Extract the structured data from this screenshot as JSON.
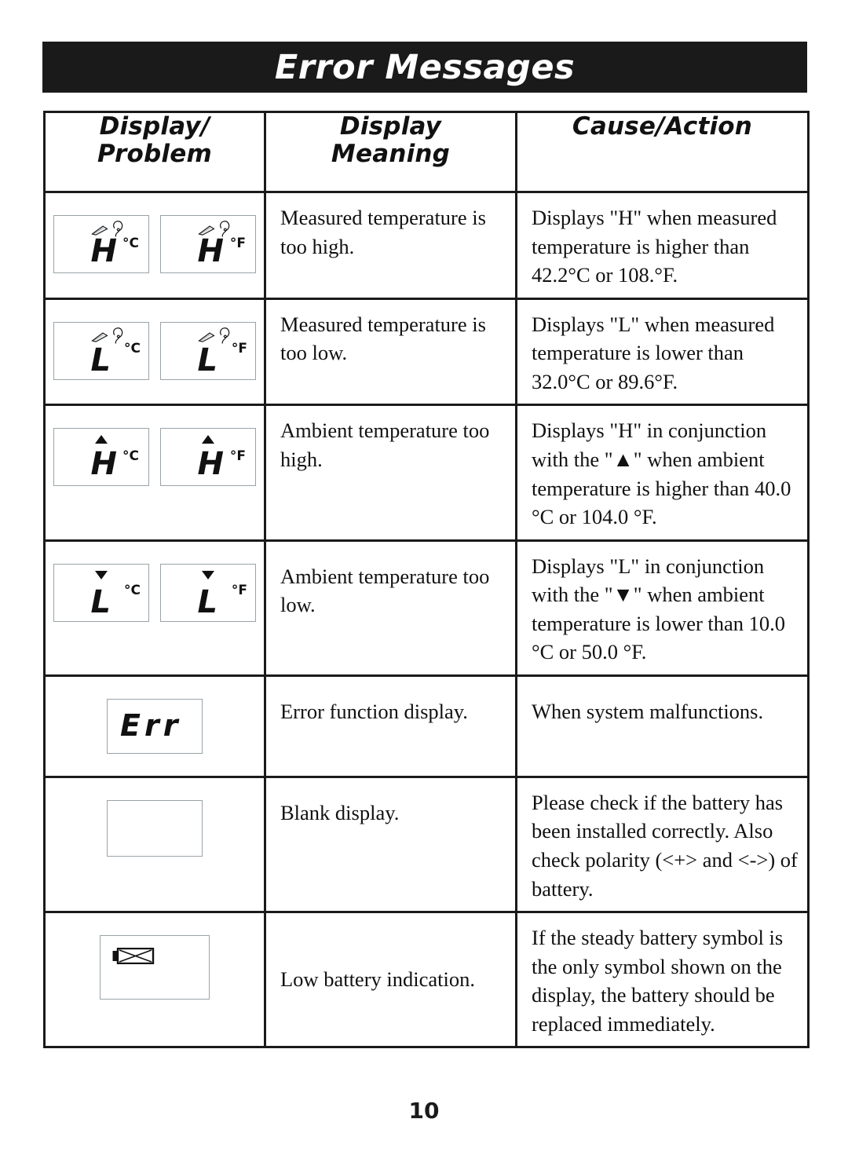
{
  "page": {
    "title": "Error Messages",
    "number": "10"
  },
  "table": {
    "headers": [
      {
        "label": "Display/\nProblem",
        "line1": "Display/",
        "line2": "Problem"
      },
      {
        "label": "Display\nMeaning",
        "line1": "Display",
        "line2": "Meaning"
      },
      {
        "label": "Cause/Action",
        "line1": "Cause/Action",
        "line2": ""
      }
    ],
    "rows": [
      {
        "display": {
          "kind": "two-lcd",
          "panels": [
            {
              "char": "H",
              "unit": "°C",
              "icons": [
                "probe-icon",
                "ear-icon"
              ],
              "marker": ""
            },
            {
              "char": "H",
              "unit": "°F",
              "icons": [
                "probe-icon",
                "ear-icon"
              ],
              "marker": ""
            }
          ]
        },
        "meaning": "Measured temperature is too high.",
        "cause": "Displays \"H\" when measured temperature is higher than 42.2°C or 108.°F."
      },
      {
        "display": {
          "kind": "two-lcd",
          "panels": [
            {
              "char": "L",
              "unit": "°C",
              "icons": [
                "probe-icon",
                "ear-icon"
              ],
              "marker": ""
            },
            {
              "char": "L",
              "unit": "°F",
              "icons": [
                "probe-icon",
                "ear-icon"
              ],
              "marker": ""
            }
          ]
        },
        "meaning": "Measured temperature is too low.",
        "cause": "Displays \"L\" when measured temperature is lower than 32.0°C or 89.6°F."
      },
      {
        "display": {
          "kind": "two-lcd",
          "panels": [
            {
              "char": "H",
              "unit": "°C",
              "icons": [],
              "marker": "triangle-up-icon"
            },
            {
              "char": "H",
              "unit": "°F",
              "icons": [],
              "marker": "triangle-up-icon"
            }
          ]
        },
        "meaning": "Ambient temperature too high.",
        "cause": "Displays \"H\" in conjunction with the \"▲\" when ambient temperature is higher than 40.0 °C or 104.0 °F."
      },
      {
        "display": {
          "kind": "two-lcd",
          "panels": [
            {
              "char": "L",
              "unit": "°C",
              "icons": [],
              "marker": "triangle-down-icon"
            },
            {
              "char": "L",
              "unit": "°F",
              "icons": [],
              "marker": "triangle-down-icon"
            }
          ]
        },
        "meaning": "Ambient temperature too low.",
        "cause": "Displays \"L\" in conjunction with the \"▼\" when ambient temperature is lower than 10.0 °C or 50.0 °F."
      },
      {
        "display": {
          "kind": "err-lcd",
          "text": "Err"
        },
        "meaning": "Error function display.",
        "cause": "When system malfunctions."
      },
      {
        "display": {
          "kind": "blank-lcd",
          "text": ""
        },
        "meaning": "Blank display.",
        "cause": "Please check if the battery has been installed correctly. Also check polarity (<+> and <->) of battery."
      },
      {
        "display": {
          "kind": "battery-lcd",
          "icon": "low-battery-icon"
        },
        "meaning": "Low battery indication.",
        "cause": "If the steady battery symbol is the only symbol shown on the display, the battery should be replaced immediately."
      }
    ]
  },
  "colors": {
    "banner_bg": "#1a1a1a",
    "banner_text": "#ffffff",
    "border": "#1a1a1a",
    "lcd_border": "#9aa3a8",
    "text": "#111111"
  }
}
